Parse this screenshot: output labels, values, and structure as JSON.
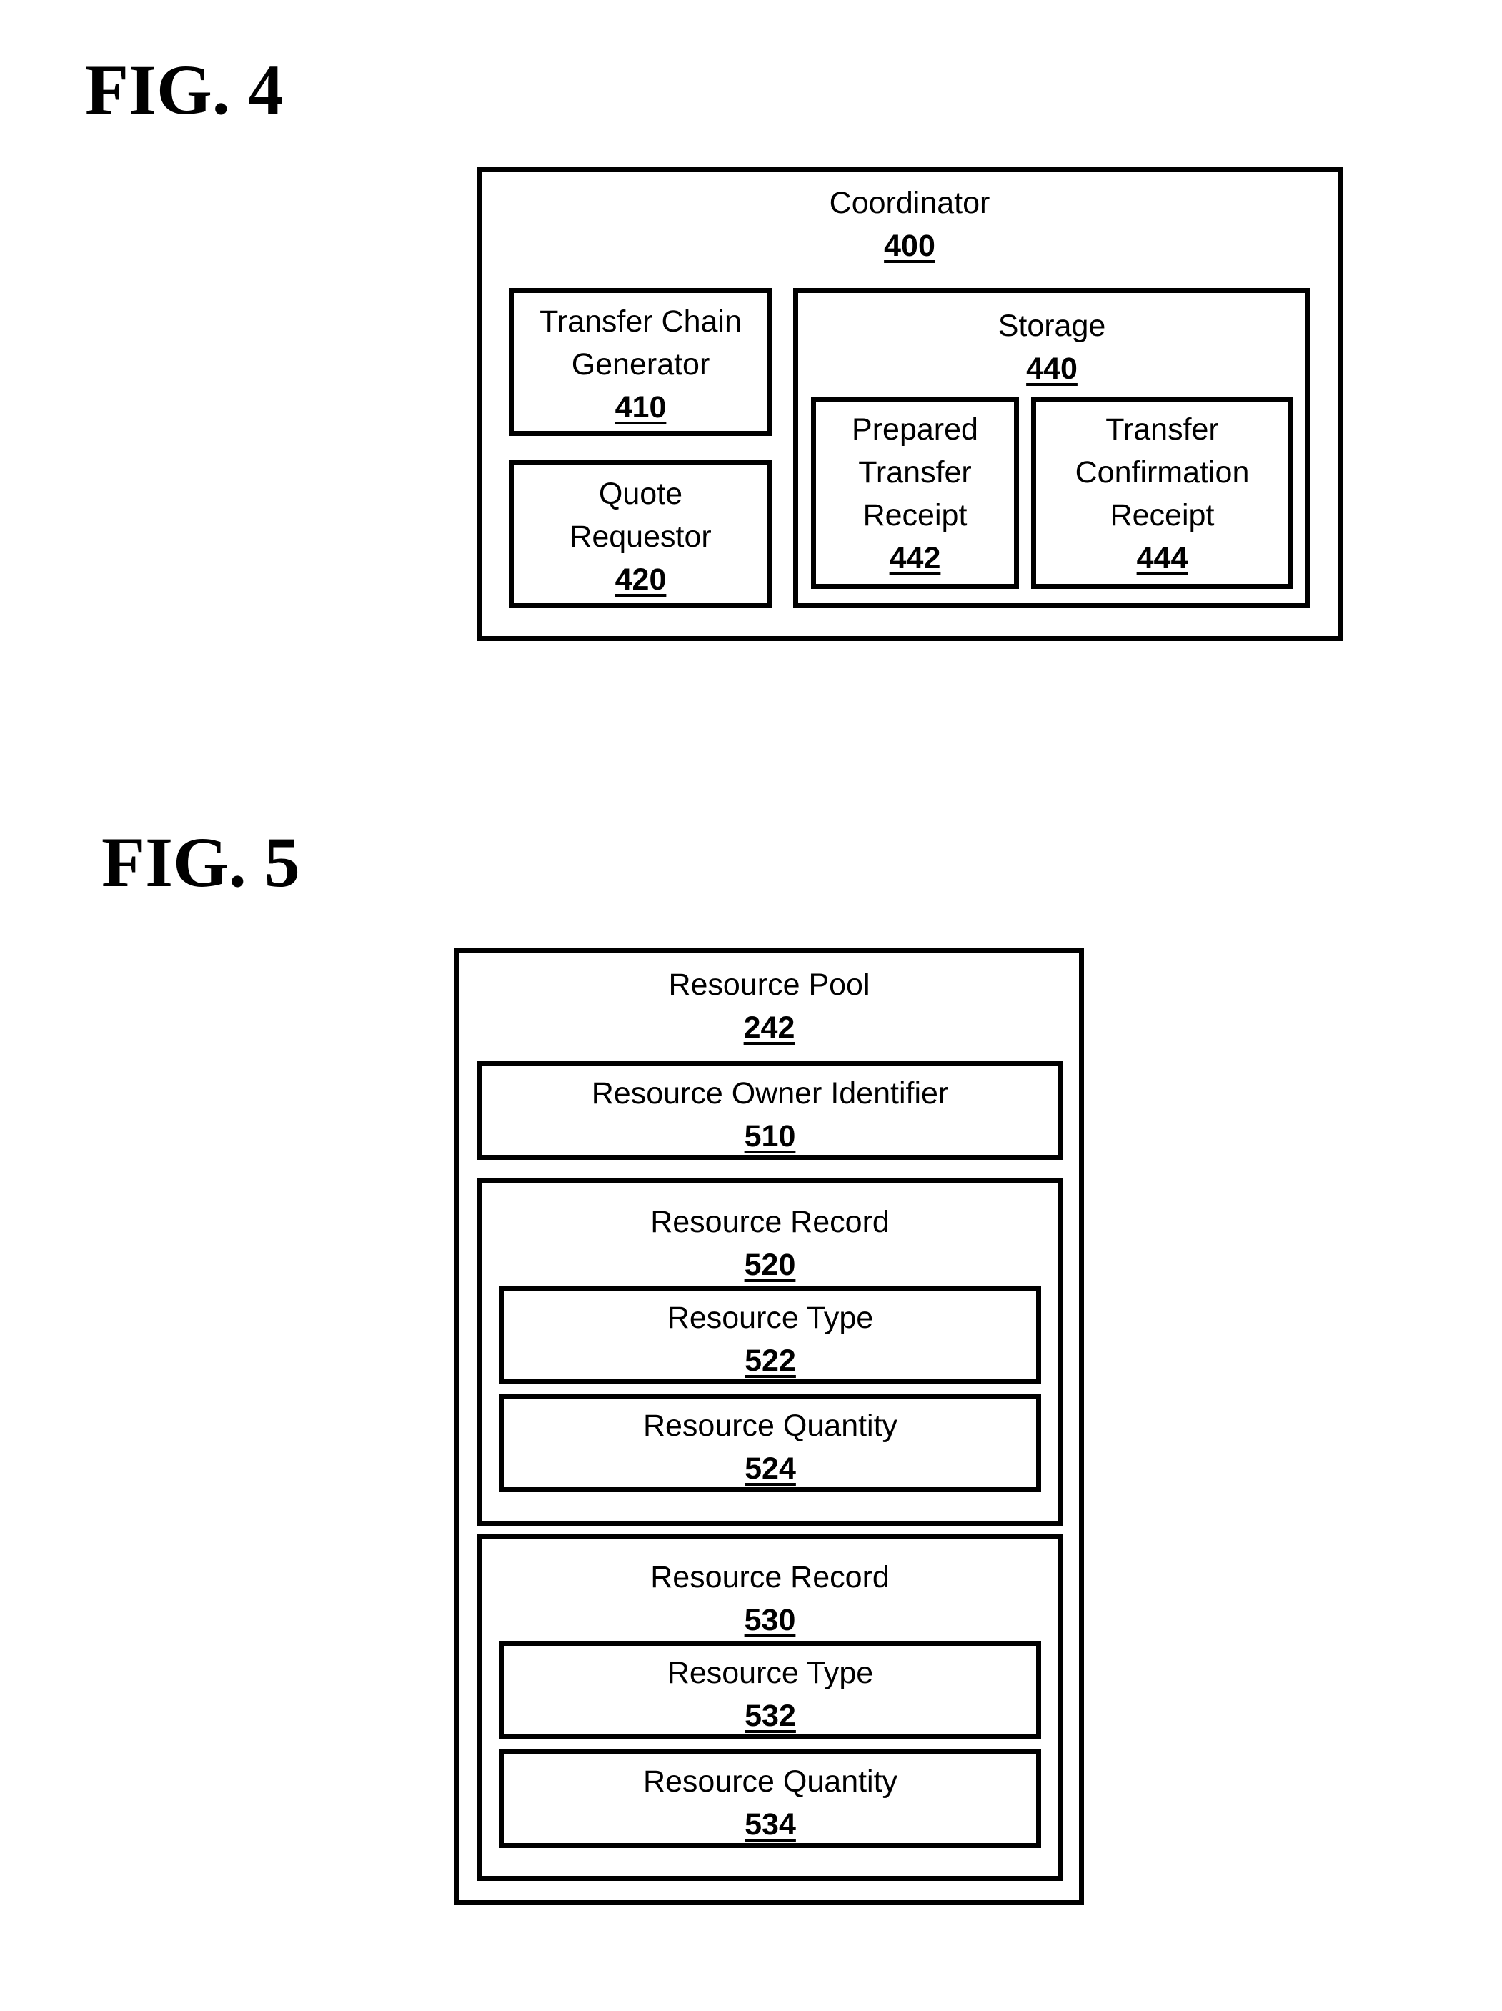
{
  "figures": [
    {
      "label": "FIG. 4",
      "coordinator": {
        "name": "Coordinator",
        "ref": "400",
        "transfer_chain_generator": {
          "name": "Transfer Chain\nGenerator",
          "ref": "410"
        },
        "quote_requestor": {
          "name": "Quote\nRequestor",
          "ref": "420"
        },
        "storage": {
          "name": "Storage",
          "ref": "440",
          "prepared_transfer_receipt": {
            "name": "Prepared\nTransfer\nReceipt",
            "ref": "442"
          },
          "transfer_confirmation_receipt": {
            "name": "Transfer\nConfirmation\nReceipt",
            "ref": "444"
          }
        }
      }
    },
    {
      "label": "FIG. 5",
      "resource_pool": {
        "name": "Resource Pool",
        "ref": "242",
        "owner_identifier": {
          "name": "Resource Owner Identifier",
          "ref": "510"
        },
        "records": [
          {
            "name": "Resource Record",
            "ref": "520",
            "type": {
              "name": "Resource Type",
              "ref": "522"
            },
            "quantity": {
              "name": "Resource Quantity",
              "ref": "524"
            }
          },
          {
            "name": "Resource Record",
            "ref": "530",
            "type": {
              "name": "Resource Type",
              "ref": "532"
            },
            "quantity": {
              "name": "Resource Quantity",
              "ref": "534"
            }
          }
        ]
      }
    }
  ]
}
